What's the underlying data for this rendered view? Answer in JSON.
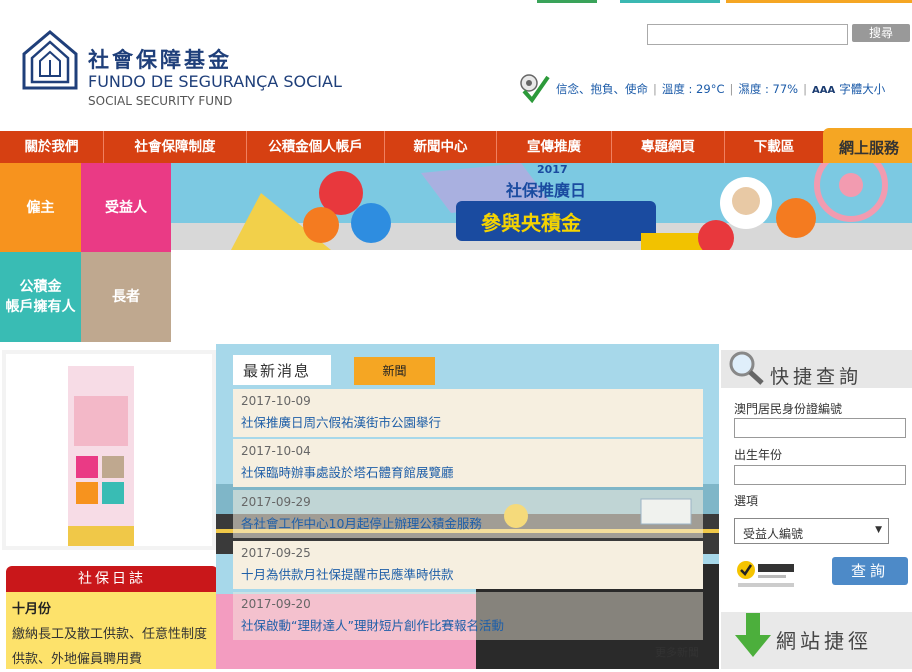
{
  "header": {
    "org_name_zh": "社會保障基金",
    "org_name_pt": "FUNDO DE SEGURANÇA SOCIAL",
    "org_name_en": "SOCIAL SECURITY FUND",
    "search_button": "搜尋",
    "search_placeholder": "",
    "motto": "信念、抱負、使命",
    "temperature": "溫度 : 29°C",
    "humidity": "濕度 : 77%",
    "font_size_glyph": "AAA",
    "font_size_label": "字體大小"
  },
  "nav": {
    "items": [
      "關於我們",
      "社會保障制度",
      "公積金個人帳戶",
      "新聞中心",
      "宣傳推廣",
      "專題網頁",
      "下載區"
    ],
    "online_service": "網上服務"
  },
  "tiles": [
    "僱主",
    "受益人",
    "公積金帳戶擁有人",
    "長者"
  ],
  "tiles_lines": {
    "t3a": "公積金",
    "t3b": "帳戶擁有人"
  },
  "banner": {
    "year": "2017",
    "title": "社保推廣日",
    "slogan": "參與央積金"
  },
  "diary": {
    "title": "社保日誌",
    "month": "十月份",
    "text": "繳納長工及散工供款、任意性制度供款、外地僱員聘用費"
  },
  "news": {
    "title": "最新消息",
    "tab": "新聞",
    "items": [
      {
        "date": "2017-10-09",
        "title": "社保推廣日周六假祐漢街市公園舉行"
      },
      {
        "date": "2017-10-04",
        "title": "社保臨時辦事處設於塔石體育館展覽廳"
      },
      {
        "date": "2017-09-29",
        "title": "各社會工作中心10月起停止辦理公積金服務"
      },
      {
        "date": "2017-09-25",
        "title": "十月為供款月社保提醒市民應準時供款"
      },
      {
        "date": "2017-09-20",
        "title": "社保啟動“理財達人”理財短片創作比賽報名活動"
      }
    ],
    "more": "更多新聞"
  },
  "quick_search": {
    "title": "快捷查詢",
    "id_label": "澳門居民身份證編號",
    "birth_year_label": "出生年份",
    "option_label": "選項",
    "option_value": "受益人編號",
    "submit": "查詢"
  },
  "links": {
    "title": "網站捷徑"
  },
  "colors": {
    "nav": "#d64012",
    "tile_orange": "#f7931e",
    "tile_pink": "#ea3a85",
    "tile_teal": "#39bcb4",
    "tile_tan": "#bfa88f"
  }
}
